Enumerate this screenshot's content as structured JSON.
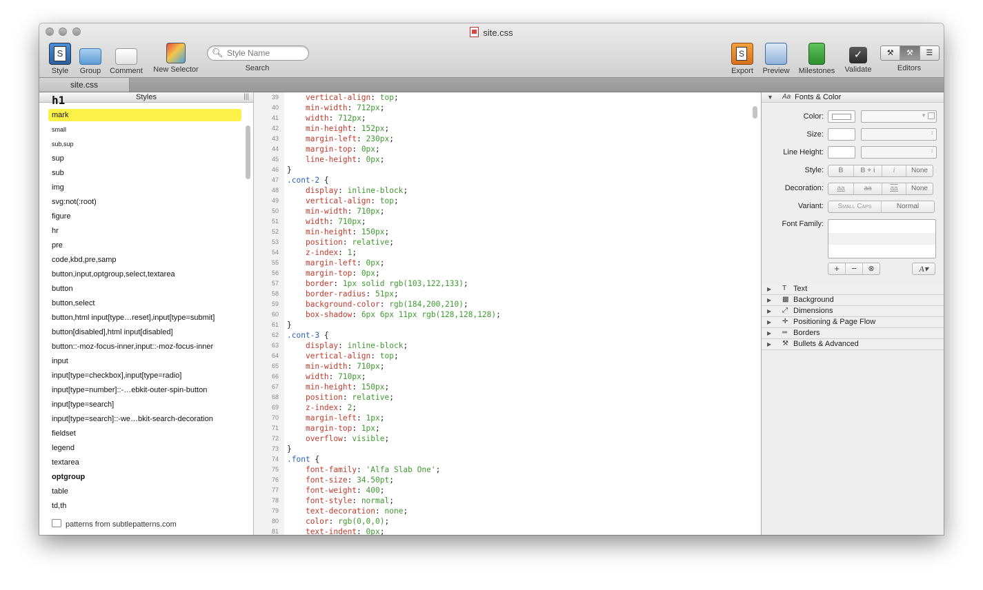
{
  "window": {
    "title": "site.css"
  },
  "toolbar": {
    "style_label": "Style",
    "group_label": "Group",
    "comment_label": "Comment",
    "new_selector_label": "New Selector",
    "search_placeholder": "Style Name",
    "search_label": "Search",
    "export_label": "Export",
    "preview_label": "Preview",
    "milestones_label": "Milestones",
    "validate_label": "Validate",
    "editors_label": "Editors"
  },
  "tabs": [
    {
      "label": "site.css"
    }
  ],
  "styles_panel": {
    "header": "Styles",
    "items": [
      "h1",
      "mark",
      "small",
      "sub,sup",
      "sup",
      "sub",
      "img",
      "svg:not(:root)",
      "figure",
      "hr",
      "pre",
      "code,kbd,pre,samp",
      "button,input,optgroup,select,textarea",
      "button",
      "button,select",
      "button,html input[type…reset],input[type=submit]",
      "button[disabled],html input[disabled]",
      "button::-moz-focus-inner,input::-moz-focus-inner",
      "input",
      "input[type=checkbox],input[type=radio]",
      "input[type=number]::-…ebkit-outer-spin-button",
      "input[type=search]",
      "input[type=search]::-we…bkit-search-decoration",
      "fieldset",
      "legend",
      "textarea",
      "optgroup",
      "table",
      "td,th"
    ],
    "selected": "mark",
    "footer": "patterns from subtlepatterns.com"
  },
  "code": {
    "lines": [
      {
        "n": "39",
        "t": "    vertical-align: top;"
      },
      {
        "n": "40",
        "t": "    min-width: 712px;"
      },
      {
        "n": "41",
        "t": "    width: 712px;"
      },
      {
        "n": "42",
        "t": "    min-height: 152px;"
      },
      {
        "n": "43",
        "t": "    margin-left: 230px;"
      },
      {
        "n": "44",
        "t": "    margin-top: 0px;"
      },
      {
        "n": "45",
        "t": "    line-height: 0px;"
      },
      {
        "n": "46",
        "t": "}"
      },
      {
        "n": "47",
        "t": ".cont-2 {"
      },
      {
        "n": "48",
        "t": "    display: inline-block;"
      },
      {
        "n": "49",
        "t": "    vertical-align: top;"
      },
      {
        "n": "50",
        "t": "    min-width: 710px;"
      },
      {
        "n": "51",
        "t": "    width: 710px;"
      },
      {
        "n": "52",
        "t": "    min-height: 150px;"
      },
      {
        "n": "53",
        "t": "    position: relative;"
      },
      {
        "n": "54",
        "t": "    z-index: 1;"
      },
      {
        "n": "55",
        "t": "    margin-left: 0px;"
      },
      {
        "n": "56",
        "t": "    margin-top: 0px;"
      },
      {
        "n": "57",
        "t": "    border: 1px solid rgb(103,122,133);"
      },
      {
        "n": "58",
        "t": "    border-radius: 51px;"
      },
      {
        "n": "59",
        "t": "    background-color: rgb(184,200,210);"
      },
      {
        "n": "60",
        "t": "    box-shadow: 6px 6px 11px rgb(128,128,128);"
      },
      {
        "n": "61",
        "t": "}"
      },
      {
        "n": "62",
        "t": ".cont-3 {"
      },
      {
        "n": "63",
        "t": "    display: inline-block;"
      },
      {
        "n": "64",
        "t": "    vertical-align: top;"
      },
      {
        "n": "65",
        "t": "    min-width: 710px;"
      },
      {
        "n": "66",
        "t": "    width: 710px;"
      },
      {
        "n": "67",
        "t": "    min-height: 150px;"
      },
      {
        "n": "68",
        "t": "    position: relative;"
      },
      {
        "n": "69",
        "t": "    z-index: 2;"
      },
      {
        "n": "70",
        "t": "    margin-left: 1px;"
      },
      {
        "n": "71",
        "t": "    margin-top: 1px;"
      },
      {
        "n": "72",
        "t": "    overflow: visible;"
      },
      {
        "n": "73",
        "t": "}"
      },
      {
        "n": "74",
        "t": ".font {"
      },
      {
        "n": "75",
        "t": "    font-family: 'Alfa Slab One';"
      },
      {
        "n": "76",
        "t": "    font-size: 34.50pt;"
      },
      {
        "n": "77",
        "t": "    font-weight: 400;"
      },
      {
        "n": "78",
        "t": "    font-style: normal;"
      },
      {
        "n": "79",
        "t": "    text-decoration: none;"
      },
      {
        "n": "80",
        "t": "    color: rgb(0,0,0);"
      },
      {
        "n": "81",
        "t": "    text-indent: 0px;"
      }
    ],
    "colors": {
      "property": "#c0392b",
      "value": "#3d9a2e",
      "selector": "#2a62b8",
      "brace": "#222222"
    }
  },
  "inspector": {
    "section_title": "Fonts & Color",
    "color_label": "Color:",
    "size_label": "Size:",
    "line_height_label": "Line Height:",
    "style_label": "Style:",
    "style_options": [
      "B",
      "B + i",
      "i",
      "None"
    ],
    "decoration_label": "Decoration:",
    "decoration_options": [
      "aa",
      "aa",
      "aa",
      "None"
    ],
    "variant_label": "Variant:",
    "variant_options": [
      "Small Caps",
      "Normal"
    ],
    "font_family_label": "Font Family:",
    "sections": [
      {
        "label": "Text",
        "icon": "text-icon"
      },
      {
        "label": "Background",
        "icon": "background-icon"
      },
      {
        "label": "Dimensions",
        "icon": "dimensions-icon"
      },
      {
        "label": "Positioning & Page Flow",
        "icon": "positioning-icon"
      },
      {
        "label": "Borders",
        "icon": "borders-icon"
      },
      {
        "label": "Bullets & Advanced",
        "icon": "wrench-icon"
      }
    ]
  }
}
